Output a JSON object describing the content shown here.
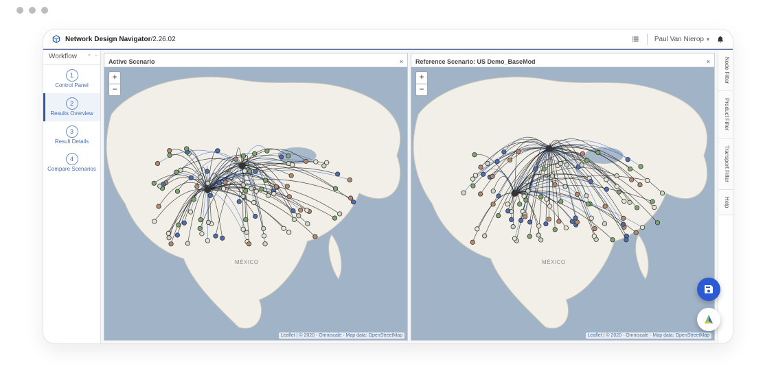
{
  "header": {
    "app_title": "Network Design Navigator",
    "version": "2.26.02",
    "user_name": "Paul Van Nierop"
  },
  "workflow": {
    "title": "Workflow",
    "steps": [
      {
        "num": "1",
        "label": "Control Panel"
      },
      {
        "num": "2",
        "label": "Results Overview"
      },
      {
        "num": "3",
        "label": "Result Details"
      },
      {
        "num": "4",
        "label": "Compare Scenarios"
      }
    ],
    "selected_index": 1
  },
  "right_tabs": [
    "Node Filter",
    "Product Filter",
    "Transport Filter",
    "Help"
  ],
  "maps": {
    "left": {
      "title": "Active Scenario",
      "attribution": "Leaflet | © 2020 · Omniscale · Map data: OpenStreetMap",
      "mexico_label": "MÉXICO"
    },
    "right": {
      "title": "Reference Scenario: US Demo_BaseMod",
      "attribution": "Leaflet | © 2020 · Omniscale · Map data: OpenStreetMap",
      "mexico_label": "MÉXICO"
    },
    "zoom": {
      "in": "+",
      "out": "−"
    }
  },
  "icons": {
    "app_logo": "cube-icon",
    "list": "list-icon",
    "bell": "bell-icon",
    "caret": "▾",
    "close": "×",
    "save": "floppy-icon",
    "compass": "compass-triangle-icon"
  },
  "colors": {
    "accent": "#2a5ab0",
    "sea": "#a1b3c7",
    "land": "#f1efe8",
    "fab_blue": "#2c5ad3"
  }
}
